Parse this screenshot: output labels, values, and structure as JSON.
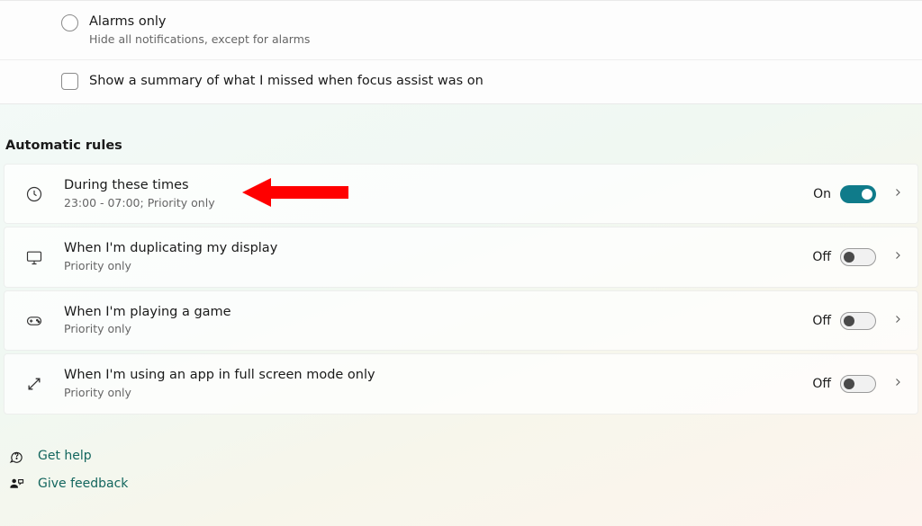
{
  "top_options": {
    "alarms": {
      "title": "Alarms only",
      "sub": "Hide all notifications, except for alarms"
    },
    "summary": {
      "label": "Show a summary of what I missed when focus assist was on"
    }
  },
  "section_header": "Automatic rules",
  "rules": [
    {
      "title": "During these times",
      "sub": "23:00 - 07:00; Priority only",
      "state_label": "On",
      "on": true
    },
    {
      "title": "When I'm duplicating my display",
      "sub": "Priority only",
      "state_label": "Off",
      "on": false
    },
    {
      "title": "When I'm playing a game",
      "sub": "Priority only",
      "state_label": "Off",
      "on": false
    },
    {
      "title": "When I'm using an app in full screen mode only",
      "sub": "Priority only",
      "state_label": "Off",
      "on": false
    }
  ],
  "footer": {
    "help": "Get help",
    "feedback": "Give feedback"
  }
}
